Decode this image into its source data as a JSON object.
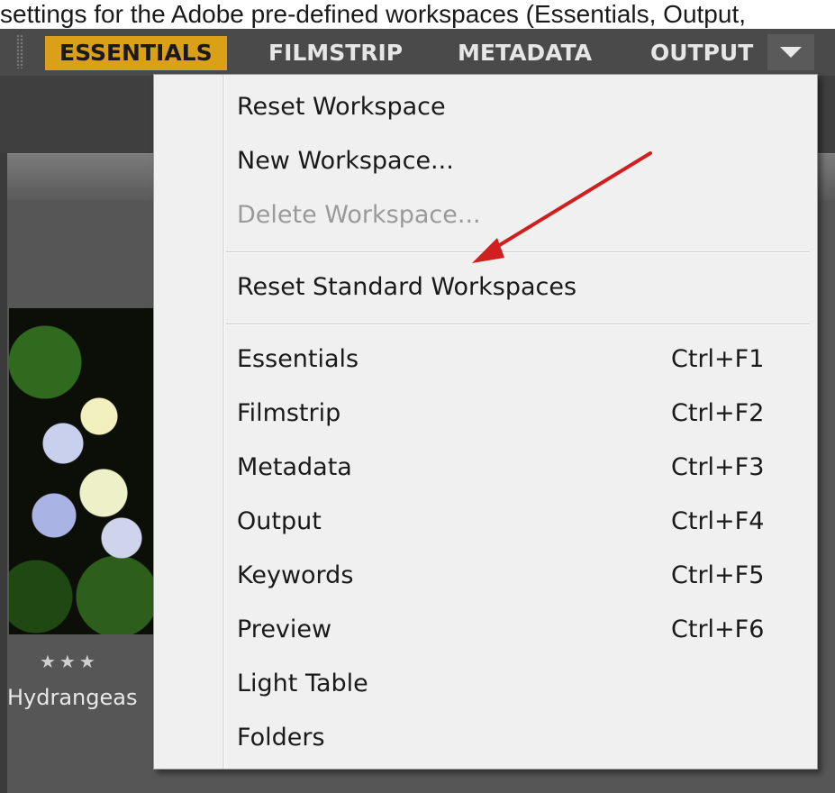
{
  "caption": {
    "text": "settings for the Adobe pre-defined workspaces (Essentials, Output,"
  },
  "workspace_bar": {
    "tabs": [
      {
        "label": "ESSENTIALS",
        "active": true
      },
      {
        "label": "FILMSTRIP",
        "active": false
      },
      {
        "label": "METADATA",
        "active": false
      },
      {
        "label": "OUTPUT",
        "active": false
      }
    ],
    "dropdown_icon": "triangle-down-icon",
    "accent_color": "#d9a018"
  },
  "menu": {
    "actions": [
      {
        "label": "Reset Workspace",
        "enabled": true
      },
      {
        "label": "New Workspace...",
        "enabled": true
      },
      {
        "label": "Delete Workspace...",
        "enabled": false
      }
    ],
    "reset_standard": {
      "label": "Reset Standard Workspaces",
      "enabled": true
    },
    "workspaces": [
      {
        "label": "Essentials",
        "shortcut": "Ctrl+F1"
      },
      {
        "label": "Filmstrip",
        "shortcut": "Ctrl+F2"
      },
      {
        "label": "Metadata",
        "shortcut": "Ctrl+F3"
      },
      {
        "label": "Output",
        "shortcut": "Ctrl+F4"
      },
      {
        "label": "Keywords",
        "shortcut": "Ctrl+F5"
      },
      {
        "label": "Preview",
        "shortcut": "Ctrl+F6"
      },
      {
        "label": "Light Table",
        "shortcut": ""
      },
      {
        "label": "Folders",
        "shortcut": ""
      }
    ]
  },
  "thumbnail": {
    "rating": "★★★",
    "label": "Hydrangeas"
  },
  "annotation": {
    "arrow_color": "#d11f1f"
  }
}
